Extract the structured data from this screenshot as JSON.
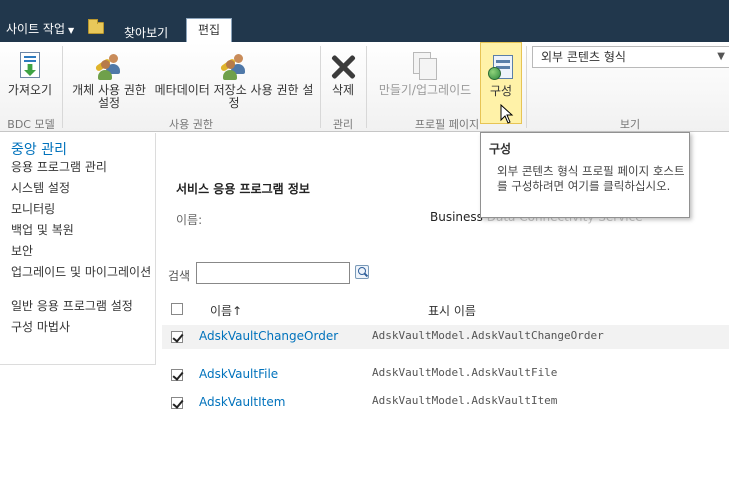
{
  "topbar": {
    "site_actions": "사이트 작업",
    "tab_browse": "찾아보기",
    "tab_edit": "편집"
  },
  "ribbon": {
    "buttons": {
      "import": "가져오기",
      "object_permissions": "개체 사용 권한 설정",
      "metadata_store_permissions": "메타데이터 저장소 사용 권한 설정",
      "delete": "삭제",
      "create_upgrade": "만들기/업그레이드",
      "configure": "구성"
    },
    "groups": {
      "bdc_models": "BDC 모델",
      "permissions": "사용 권한",
      "manage": "관리",
      "profile_pages": "프로필 페이지",
      "view": "보기"
    },
    "view_select": "외부 콘텐츠 형식"
  },
  "tooltip": {
    "title": "구성",
    "body": "외부 콘텐츠 형식 프로필 페이지 호스트를 구성하려면 여기를 클릭하십시오."
  },
  "leftnav": {
    "heading": "중앙 관리",
    "items": [
      "응용 프로그램 관리",
      "시스템 설정",
      "모니터링",
      "백업 및 복원",
      "보안",
      "업그레이드 및 마이그레이션",
      "일반 응용 프로그램 설정",
      "구성 마법사"
    ]
  },
  "main": {
    "section_title": "서비스 응용 프로그램 정보",
    "name_label": "이름:",
    "name_value": "Business",
    "name_value_faded": "Data Connectivity Service",
    "search_label": "검색",
    "search_value": "",
    "columns": {
      "name": "이름↑",
      "display_name": "표시 이름"
    },
    "rows": [
      {
        "name": "AdskVaultChangeOrder",
        "display_name": "AdskVaultModel.AdskVaultChangeOrder",
        "checked": true
      },
      {
        "name": "AdskVaultFile",
        "display_name": "AdskVaultModel.AdskVaultFile",
        "checked": true
      },
      {
        "name": "AdskVaultItem",
        "display_name": "AdskVaultModel.AdskVaultItem",
        "checked": true
      }
    ]
  }
}
